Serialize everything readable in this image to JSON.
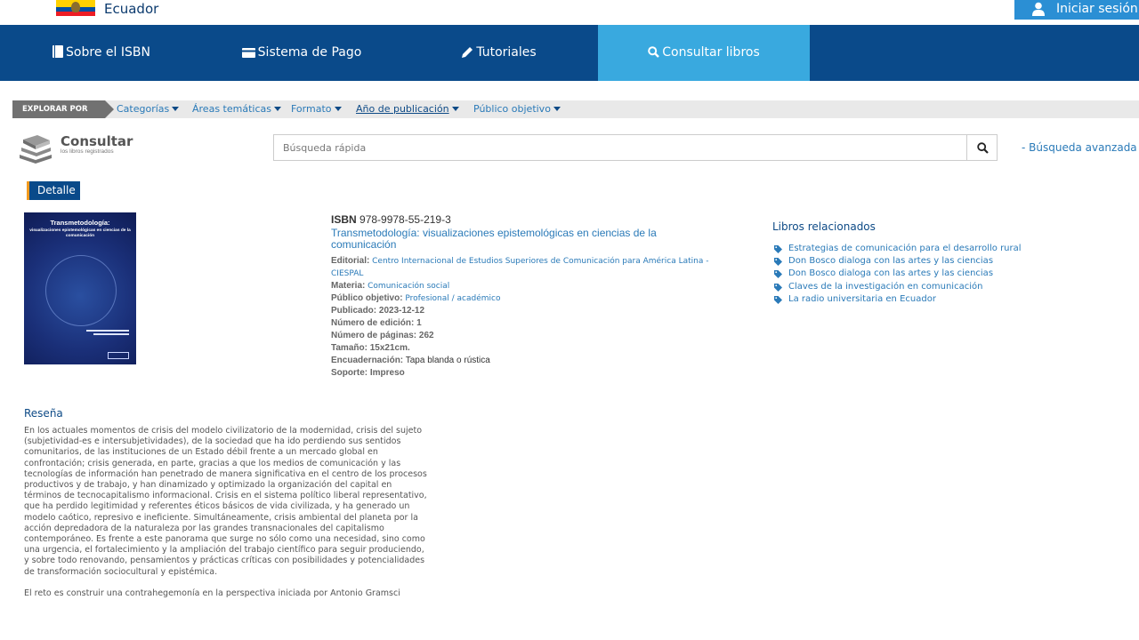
{
  "topbar": {
    "country": "Ecuador",
    "login_label": "Iniciar sesión"
  },
  "nav": {
    "items": [
      {
        "label": "Sobre el ISBN",
        "icon": "book-icon"
      },
      {
        "label": "Sistema de Pago",
        "icon": "credit-card-icon"
      },
      {
        "label": "Tutoriales",
        "icon": "pencil-icon"
      },
      {
        "label": "Consultar libros",
        "icon": "search-icon"
      }
    ]
  },
  "explore": {
    "tag": "EXPLORAR POR",
    "links": [
      "Categorías",
      "Áreas temáticas",
      "Formato",
      "Año de publicación",
      "Público objetivo"
    ]
  },
  "search": {
    "logo_title": "Consultar",
    "logo_sub": "los libros registrados",
    "placeholder": "Búsqueda rápida",
    "advanced": "- Búsqueda avanzada -"
  },
  "detail": {
    "tab": "Detalle",
    "isbn_label": "ISBN",
    "isbn": "978-9978-55-219-3",
    "title": "Transmetodología: visualizaciones epistemológicas en ciencias de la comunicación",
    "editorial_label": "Editorial:",
    "editorial": "Centro Internacional de Estudios Superiores de Comunicación para América Latina - CIESPAL",
    "materia_label": "Materia:",
    "materia": "Comunicación social",
    "publico_label": "Público objetivo:",
    "publico": "Profesional / académico",
    "publicado": "Publicado: 2023-12-12",
    "edicion": "Número de edición: 1",
    "paginas": "Número de páginas: 262",
    "tamano": "Tamaño: 15x21cm.",
    "encuadernacion_label": "Encuadernación:",
    "encuadernacion": "Tapa blanda o rústica",
    "soporte": "Soporte: Impreso"
  },
  "cover": {
    "title": "Transmetodología:",
    "subtitle": "visualizaciones epistemológicas en ciencias de la comunicación"
  },
  "related": {
    "title": "Libros relacionados",
    "items": [
      "Estrategias de comunicación para el desarrollo rural",
      "Don Bosco dialoga con las artes y las ciencias",
      "Don Bosco dialoga con las artes y las ciencias",
      "Claves de la investigación en comunicación",
      "La radio universitaria en Ecuador"
    ]
  },
  "review": {
    "title": "Reseña",
    "p1": "En los actuales momentos de crisis del modelo civilizatorio de la modernidad, crisis del sujeto (subjetividad-es e intersubjetividades), de la sociedad que ha ido perdiendo sus sentidos comunitarios, de las instituciones de un Estado débil frente a un mercado global en confrontación; crisis generada, en parte, gracias a que los medios de comunicación y las tecnologías de información han penetrado de manera significativa en el centro de los procesos productivos y de trabajo, y han dinamizado y optimizado la organización del capital en términos de tecnocapitalismo informacional. Crisis en el sistema político liberal representativo, que ha perdido legitimidad y referentes éticos básicos de vida civilizada, y ha generado un modelo caótico, represivo e ineficiente. Simultáneamente, crisis ambiental del planeta por la acción depredadora de la naturaleza por las grandes transnacionales del capitalismo contemporáneo. Es frente a este panorama que surge no sólo como una necesidad, sino como una urgencia, el fortalecimiento y la ampliación del trabajo científico para seguir produciendo, y sobre todo renovando, pensamientos y prácticas críticas con posibilidades y potencialidades de transformación sociocultural y epistémica.",
    "p2": "El reto es construir una contrahegemonía en la perspectiva iniciada por Antonio Gramsci"
  },
  "colors": {
    "nav_bg": "#0a4a8a",
    "nav_active": "#39a9df",
    "link": "#2a7ab8",
    "login_bg": "#2b8fd4"
  }
}
